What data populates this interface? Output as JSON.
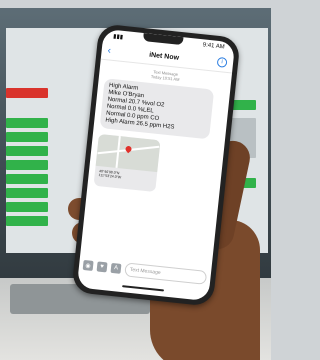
{
  "status_bar": {
    "time": "9:41 AM"
  },
  "conversation": {
    "contact": "iNet Now",
    "meta_line_1": "Text Message",
    "meta_line_2": "Today 10:51 AM"
  },
  "message": {
    "lines": [
      "High Alarm",
      "Mike O'Bryan",
      "Normal 20.7 %vol O2",
      "Normal 0.0 %LEL",
      "Normal 0.0 ppm CO",
      "High Alarm 26.5 ppm H2S"
    ],
    "map_coords": [
      "40°46'08.0\"N",
      "111°53'24.0\"W"
    ]
  },
  "composer": {
    "placeholder": "Text Message",
    "icons": [
      "camera-icon",
      "heart-icon",
      "apps-icon"
    ]
  },
  "colors": {
    "alarm_red": "#d9332c",
    "normal_green": "#31b24a",
    "ios_blue": "#2a7de1",
    "bubble_gray": "#e9e9eb",
    "skin": "#7a4a2c"
  }
}
